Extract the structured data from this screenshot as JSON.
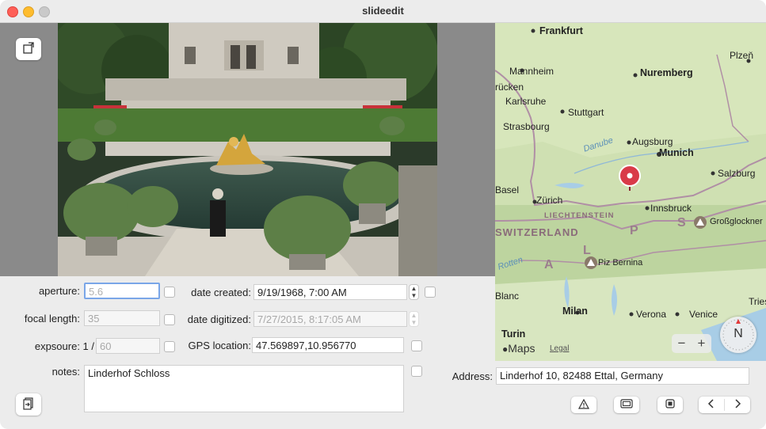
{
  "window": {
    "title": "slideedit"
  },
  "form": {
    "aperture_label": "aperture:",
    "aperture_placeholder": "5.6",
    "focal_length_label": "focal length:",
    "focal_length_placeholder": "35",
    "exposure_label": "expsoure: 1 /",
    "exposure_placeholder": "60",
    "notes_label": "notes:",
    "notes_value": "Linderhof Schloss",
    "date_created_label": "date created:",
    "date_created_value": "9/19/1968,    7:00 AM",
    "date_digitized_label": "date digitized:",
    "date_digitized_value": "7/27/2015,    8:17:05 AM",
    "gps_label": "GPS location:",
    "gps_value": "47.569897,10.956770",
    "address_label": "Address:",
    "address_value": "Linderhof 10, 82488 Ettal, Germany"
  },
  "map": {
    "brand": "Maps",
    "legal": "Legal",
    "zoom_out": "−",
    "zoom_in": "+",
    "compass": "N",
    "labels": {
      "frankfurt": "Frankfurt",
      "plzen": "Plzeň",
      "mannheim": "Mannheim",
      "nuremberg": "Nuremberg",
      "rucken": "rücken",
      "karlsruhe": "Karlsruhe",
      "stuttgart": "Stuttgart",
      "strasbourg": "Strasbourg",
      "danube": "Danube",
      "augsburg": "Augsburg",
      "munich": "Munich",
      "salzburg": "Salzburg",
      "basel": "Basel",
      "zurich": "Zürich",
      "liechtenstein": "LIECHTENSTEIN",
      "innsbruck": "Innsbruck",
      "grossglockner": "Großglockner",
      "switzerland": "SWITZERLAND",
      "alps_p": "P",
      "alps_s": "S",
      "alps_a": "A",
      "alps_l": "L",
      "rotten": "Rotten",
      "piz_bernina": "Piz Bernina",
      "blanc": "Blanc",
      "milan": "Milan",
      "verona": "Verona",
      "venice": "Venice",
      "triest": "Triest",
      "turin": "Turin"
    }
  }
}
